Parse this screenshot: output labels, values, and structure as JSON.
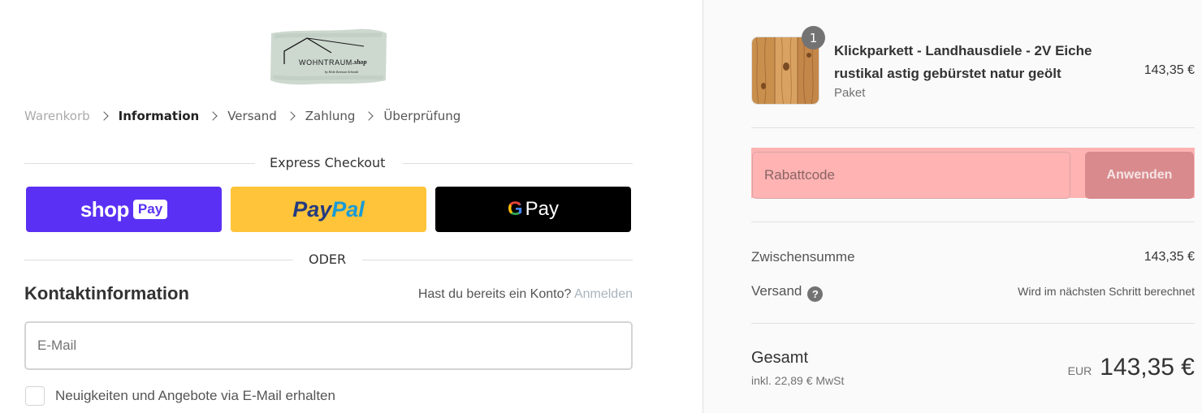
{
  "brand": {
    "logo_text": "WOHNTRAUM",
    "logo_suffix": ".shop",
    "logo_tagline": "by Holz-Zentrum Schmidt"
  },
  "breadcrumb": [
    "Warenkorb",
    "Information",
    "Versand",
    "Zahlung",
    "Überprüfung"
  ],
  "express": {
    "title": "Express Checkout",
    "shop_pay": {
      "word": "shop",
      "badge": "Pay"
    },
    "paypal": {
      "part1": "Pay",
      "part2": "Pal"
    },
    "gpay": {
      "g": "G",
      "word": "Pay"
    },
    "or_label": "ODER"
  },
  "contact": {
    "title": "Kontaktinformation",
    "account_question": "Hast du bereits ein Konto?",
    "login_link": "Anmelden",
    "email_placeholder": "E-Mail",
    "newsletter_label": "Neuigkeiten und Angebote via E-Mail erhalten"
  },
  "summary": {
    "product": {
      "quantity": "1",
      "name": "Klickparkett - Landhausdiele - 2V Eiche rustikal astig gebürstet natur geölt",
      "variant": "Paket",
      "price": "143,35 €"
    },
    "discount": {
      "placeholder": "Rabattcode",
      "button": "Anwenden"
    },
    "subtotal": {
      "label": "Zwischensumme",
      "value": "143,35 €"
    },
    "shipping": {
      "label": "Versand",
      "help": "?",
      "value": "Wird im nächsten Schritt berechnet"
    },
    "total": {
      "label": "Gesamt",
      "tax": "inkl. 22,89 € MwSt",
      "currency": "EUR",
      "value": "143,35 €"
    }
  },
  "colors": {
    "shop_pay": "#5a31f4",
    "paypal": "#ffc439",
    "gpay": "#000000",
    "discount_highlight": "#ffb3b3",
    "apply_button": "#d88a8d"
  }
}
